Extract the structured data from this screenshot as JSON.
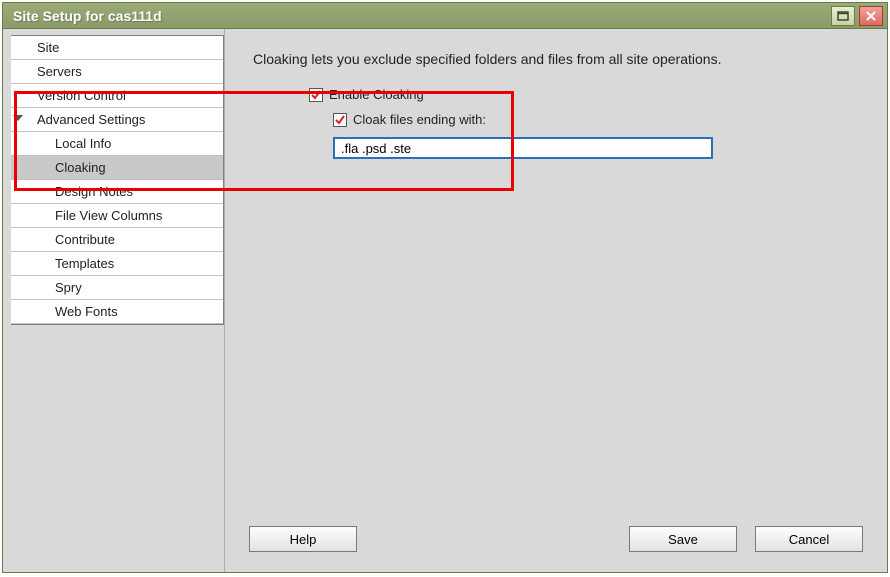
{
  "window": {
    "title": "Site Setup for cas111d"
  },
  "sidebar": {
    "items": [
      {
        "label": "Site",
        "child": false,
        "selected": false
      },
      {
        "label": "Servers",
        "child": false,
        "selected": false
      },
      {
        "label": "Version Control",
        "child": false,
        "selected": false
      },
      {
        "label": "Advanced Settings",
        "child": false,
        "selected": false,
        "expanded": true
      },
      {
        "label": "Local Info",
        "child": true,
        "selected": false
      },
      {
        "label": "Cloaking",
        "child": true,
        "selected": true
      },
      {
        "label": "Design Notes",
        "child": true,
        "selected": false
      },
      {
        "label": "File View Columns",
        "child": true,
        "selected": false
      },
      {
        "label": "Contribute",
        "child": true,
        "selected": false
      },
      {
        "label": "Templates",
        "child": true,
        "selected": false
      },
      {
        "label": "Spry",
        "child": true,
        "selected": false
      },
      {
        "label": "Web Fonts",
        "child": true,
        "selected": false
      }
    ]
  },
  "content": {
    "description": "Cloaking lets you exclude specified folders and files from all site operations.",
    "enable_label": "Enable Cloaking",
    "enable_checked": true,
    "cloak_ext_label": "Cloak files ending with:",
    "cloak_ext_checked": true,
    "ext_value": ".fla .psd .ste"
  },
  "footer": {
    "help": "Help",
    "save": "Save",
    "cancel": "Cancel"
  }
}
